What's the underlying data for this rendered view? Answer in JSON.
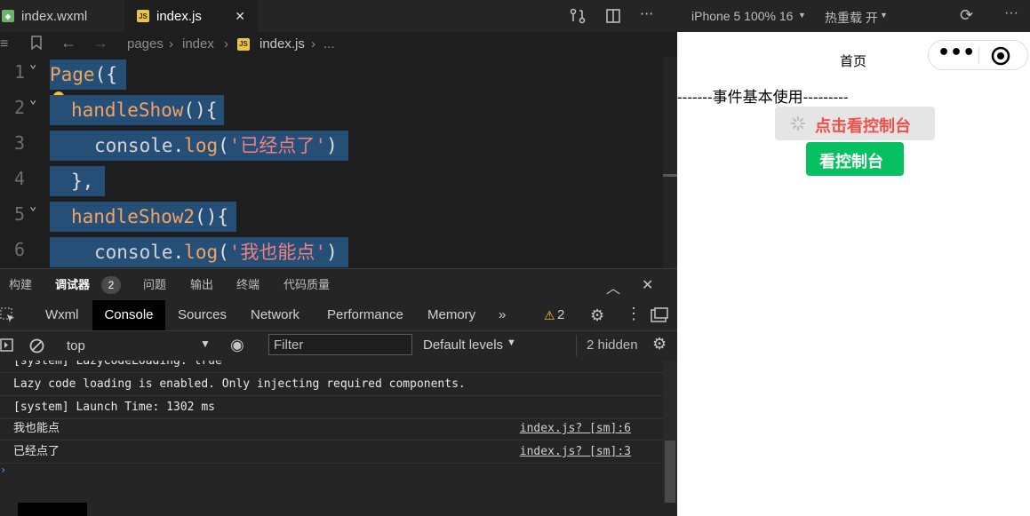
{
  "editor": {
    "tabs": [
      {
        "label": "index.wxml"
      },
      {
        "label": "index.js",
        "close": "✕"
      }
    ],
    "breadcrumb": {
      "parts": [
        "pages",
        "index",
        "index.js",
        "..."
      ]
    },
    "lines": [
      {
        "n": "1",
        "t": [
          "Page",
          "({"
        ]
      },
      {
        "n": "2",
        "t": [
          "handleShow",
          "(){"
        ]
      },
      {
        "n": "3",
        "t": [
          "console",
          ".",
          "log",
          "(",
          "'已经点了'",
          ")"
        ]
      },
      {
        "n": "4",
        "t": [
          "},"
        ]
      },
      {
        "n": "5",
        "t": [
          "handleShow2",
          "(){"
        ]
      },
      {
        "n": "6",
        "t": [
          "console",
          ".",
          "log",
          "(",
          "'我也能点'",
          ")"
        ]
      }
    ]
  },
  "panel": {
    "tabs": [
      "构建",
      "调试器",
      "问题",
      "输出",
      "终端",
      "代码质量"
    ],
    "debugger_badge": "2"
  },
  "devtools": {
    "tabs": [
      "Wxml",
      "Console",
      "Sources",
      "Network",
      "Performance",
      "Memory"
    ],
    "warn_count": "2",
    "context": "top",
    "filter_placeholder": "Filter",
    "levels": "Default levels",
    "hidden": "2 hidden"
  },
  "console": {
    "rows": [
      {
        "msg": "[system] LazyCodeLoading: true",
        "src": ""
      },
      {
        "msg": "Lazy code loading is enabled. Only injecting required components.",
        "src": ""
      },
      {
        "msg": "[system] Launch Time: 1302 ms",
        "src": ""
      },
      {
        "msg": "我也能点",
        "src": "index.js? [sm]:6"
      },
      {
        "msg": "已经点了",
        "src": "index.js? [sm]:3"
      }
    ]
  },
  "simulator": {
    "device": "iPhone 5 100% 16",
    "hot_reload": "热重载 开",
    "page_title": "首页",
    "divider_text": "-------事件基本使用---------",
    "btn1": "点击看控制台",
    "btn2": "看控制台",
    "colors": {
      "btn1_text": "#f0504a",
      "btn2_bg": "#07c160"
    }
  }
}
